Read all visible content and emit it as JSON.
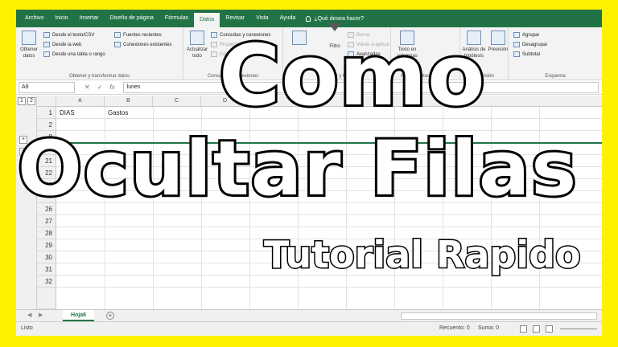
{
  "ribbon_tabs": [
    "Archivo",
    "Inicio",
    "Insertar",
    "Diseño de página",
    "Fórmulas",
    "Datos",
    "Revisar",
    "Vista",
    "Ayuda"
  ],
  "active_tab": "Datos",
  "tell_me": "¿Qué desea hacer?",
  "groups": {
    "get_data": {
      "big_label": "Obtener datos",
      "items": [
        "Desde el texto/CSV",
        "Desde la web",
        "Desde una tabla o rango",
        "Fuentes recientes",
        "Conexiones existentes"
      ],
      "label": "Obtener y transformar datos"
    },
    "queries": {
      "big_label": "Actualizar todo",
      "items": [
        "Consultas y conexiones",
        "Propiedades",
        "Editar vínculos"
      ],
      "label": "Consultas y conexiones"
    },
    "sort_filter": {
      "big_label": "Filtro",
      "items": [
        "Borrar",
        "Volver a aplicar",
        "Avanzadas"
      ],
      "label": "Ordenar y filtrar"
    },
    "data_tools": {
      "big_label": "Texto en columnas",
      "label": "Herramientas de datos"
    },
    "forecast": {
      "items": [
        "Análisis de hipótesis",
        "Previsión"
      ],
      "label": "Previsión"
    },
    "outline": {
      "items": [
        "Agrupar",
        "Desagrupar",
        "Subtotal"
      ],
      "label": "Esquema"
    }
  },
  "formula_bar": {
    "name_box": "A9",
    "fx": "fx",
    "cancel": "✕",
    "enter": "✓",
    "value": "lunes"
  },
  "columns": [
    "A",
    "B",
    "C",
    "D",
    "E",
    "F",
    "G"
  ],
  "rows": [
    "1",
    "2",
    "8",
    "",
    "21",
    "22",
    "23",
    "",
    "26",
    "27",
    "28",
    "29",
    "30",
    "31",
    "32"
  ],
  "cells": {
    "a1": "DIAS",
    "b1": "Gastos"
  },
  "outline_levels": [
    "1",
    "2"
  ],
  "expand_symbol": "+",
  "sheet_tab": "Hoja6",
  "add_sheet": "+",
  "status": {
    "mode": "Listo",
    "count": "Recuento: 0",
    "sum": "Suma: 0"
  },
  "overlay": {
    "line1": "Como",
    "line2": "Ocultar Filas",
    "line3": "Tutorial Rapido"
  },
  "colors": {
    "frame": "#fff200",
    "excel_green": "#217346",
    "overlay_stroke": "#000000",
    "overlay_fill": "#ffffff"
  }
}
